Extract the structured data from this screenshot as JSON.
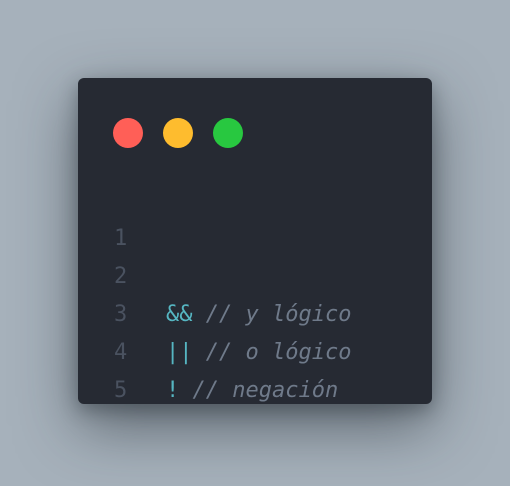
{
  "window": {
    "buttons": [
      {
        "name": "close-button",
        "color": "#ff5f57"
      },
      {
        "name": "minimize-button",
        "color": "#febc2e"
      },
      {
        "name": "maximize-button",
        "color": "#28c840"
      }
    ]
  },
  "code": {
    "lines": [
      {
        "number": "1",
        "operator": "",
        "comment": ""
      },
      {
        "number": "2",
        "operator": "&&",
        "comment": " // y lógico"
      },
      {
        "number": "3",
        "operator": "||",
        "comment": " // o lógico"
      },
      {
        "number": "4",
        "operator": "!",
        "comment": " // negación"
      },
      {
        "number": "5",
        "operator": "",
        "comment": ""
      }
    ]
  },
  "colors": {
    "background": "#a6b1bb",
    "window": "#262a33",
    "operator": "#56b6c2",
    "comment": "#6f7a8a",
    "line_number": "#4a5260"
  }
}
